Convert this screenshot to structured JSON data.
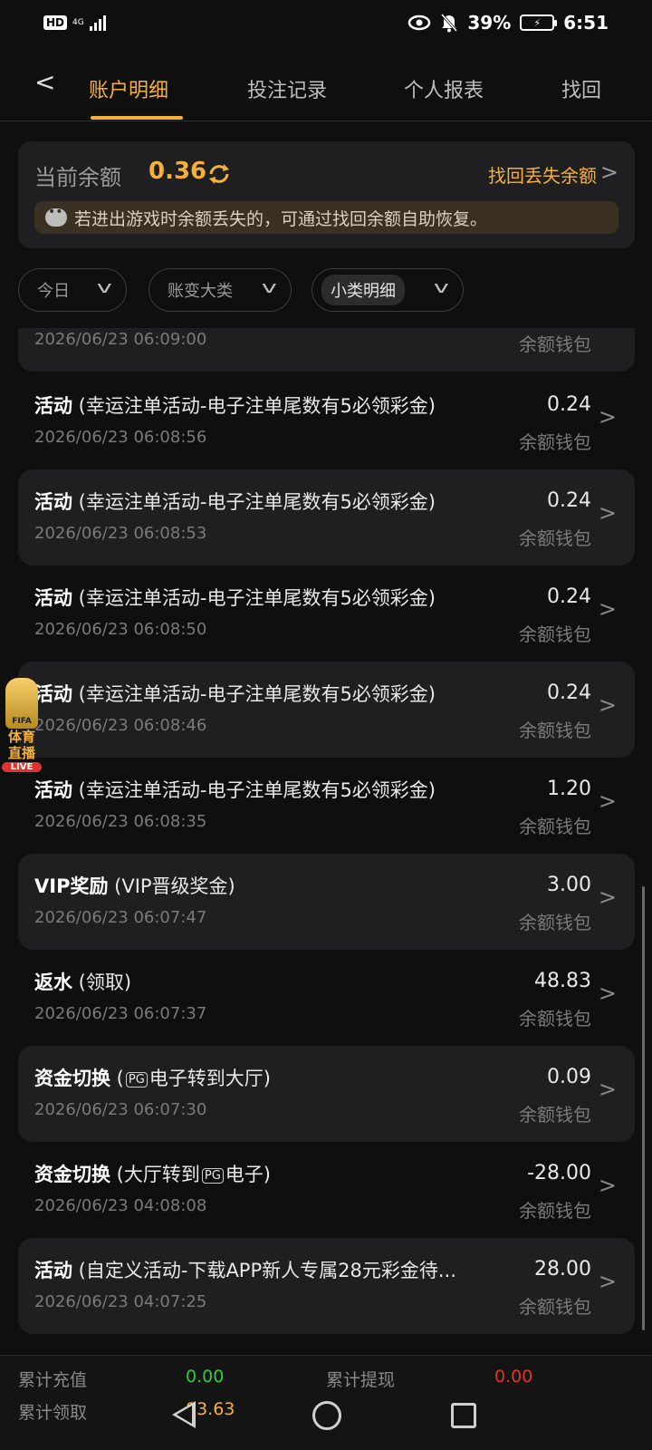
{
  "status_bar": {
    "hd": "HD",
    "network": "4G",
    "battery": "39%",
    "time": "6:51"
  },
  "tabs": [
    {
      "label": "账户明细",
      "active": true
    },
    {
      "label": "投注记录",
      "active": false
    },
    {
      "label": "个人报表",
      "active": false
    },
    {
      "label": "找回",
      "active": false
    }
  ],
  "balance": {
    "label": "当前余额",
    "value": "0.36",
    "recover_label": "找回丢失余额",
    "notice": "若进出游戏时余额丢失的，可通过找回余额自助恢复。"
  },
  "filters": {
    "date": "今日",
    "category": "账变大类",
    "subcategory": "小类明细"
  },
  "partial_record": {
    "time": "2026/06/23 06:09:00",
    "wallet": "余额钱包"
  },
  "records": [
    {
      "type": "活动",
      "desc": " (幸运注单活动-电子注单尾数有5必领彩金)",
      "time": "2026/06/23 06:08:56",
      "amount": "0.24",
      "wallet": "余额钱包"
    },
    {
      "type": "活动",
      "desc": " (幸运注单活动-电子注单尾数有5必领彩金)",
      "time": "2026/06/23 06:08:53",
      "amount": "0.24",
      "wallet": "余额钱包"
    },
    {
      "type": "活动",
      "desc": " (幸运注单活动-电子注单尾数有5必领彩金)",
      "time": "2026/06/23 06:08:50",
      "amount": "0.24",
      "wallet": "余额钱包"
    },
    {
      "type": "活动",
      "desc": " (幸运注单活动-电子注单尾数有5必领彩金)",
      "time": "2026/06/23 06:08:46",
      "amount": "0.24",
      "wallet": "余额钱包"
    },
    {
      "type": "活动",
      "desc": " (幸运注单活动-电子注单尾数有5必领彩金)",
      "time": "2026/06/23 06:08:35",
      "amount": "1.20",
      "wallet": "余额钱包"
    },
    {
      "type": "VIP奖励",
      "desc": " (VIP晋级奖金)",
      "time": "2026/06/23 06:07:47",
      "amount": "3.00",
      "wallet": "余额钱包"
    },
    {
      "type": "返水",
      "desc": " (领取)",
      "time": "2026/06/23 06:07:37",
      "amount": "48.83",
      "wallet": "余额钱包"
    },
    {
      "type": "资金切换",
      "desc_pre": " (",
      "pg": "PG",
      "desc_post": "电子转到大厅)",
      "time": "2026/06/23 06:07:30",
      "amount": "0.09",
      "wallet": "余额钱包"
    },
    {
      "type": "资金切换",
      "desc_pre": " (大厅转到",
      "pg": "PG",
      "desc_post": "电子)",
      "time": "2026/06/23 04:08:08",
      "amount": "-28.00",
      "wallet": "余额钱包"
    },
    {
      "type": "活动",
      "desc": " (自定义活动-下载APP新人专属28元彩金待...",
      "time": "2026/06/23 04:07:25",
      "amount": "28.00",
      "wallet": "余额钱包"
    }
  ],
  "fifa_widget": {
    "cup_text": "FIFA",
    "label": "体育直播",
    "live": "LIVE"
  },
  "summary": {
    "recharge_label": "累计充值",
    "recharge_value": "0.00",
    "withdraw_label": "累计提现",
    "withdraw_value": "0.00",
    "claim_label": "累计领取",
    "claim_value": "83.63"
  },
  "colors": {
    "accent": "#f3b13a",
    "green": "#2ecc40",
    "red": "#e0322e"
  }
}
